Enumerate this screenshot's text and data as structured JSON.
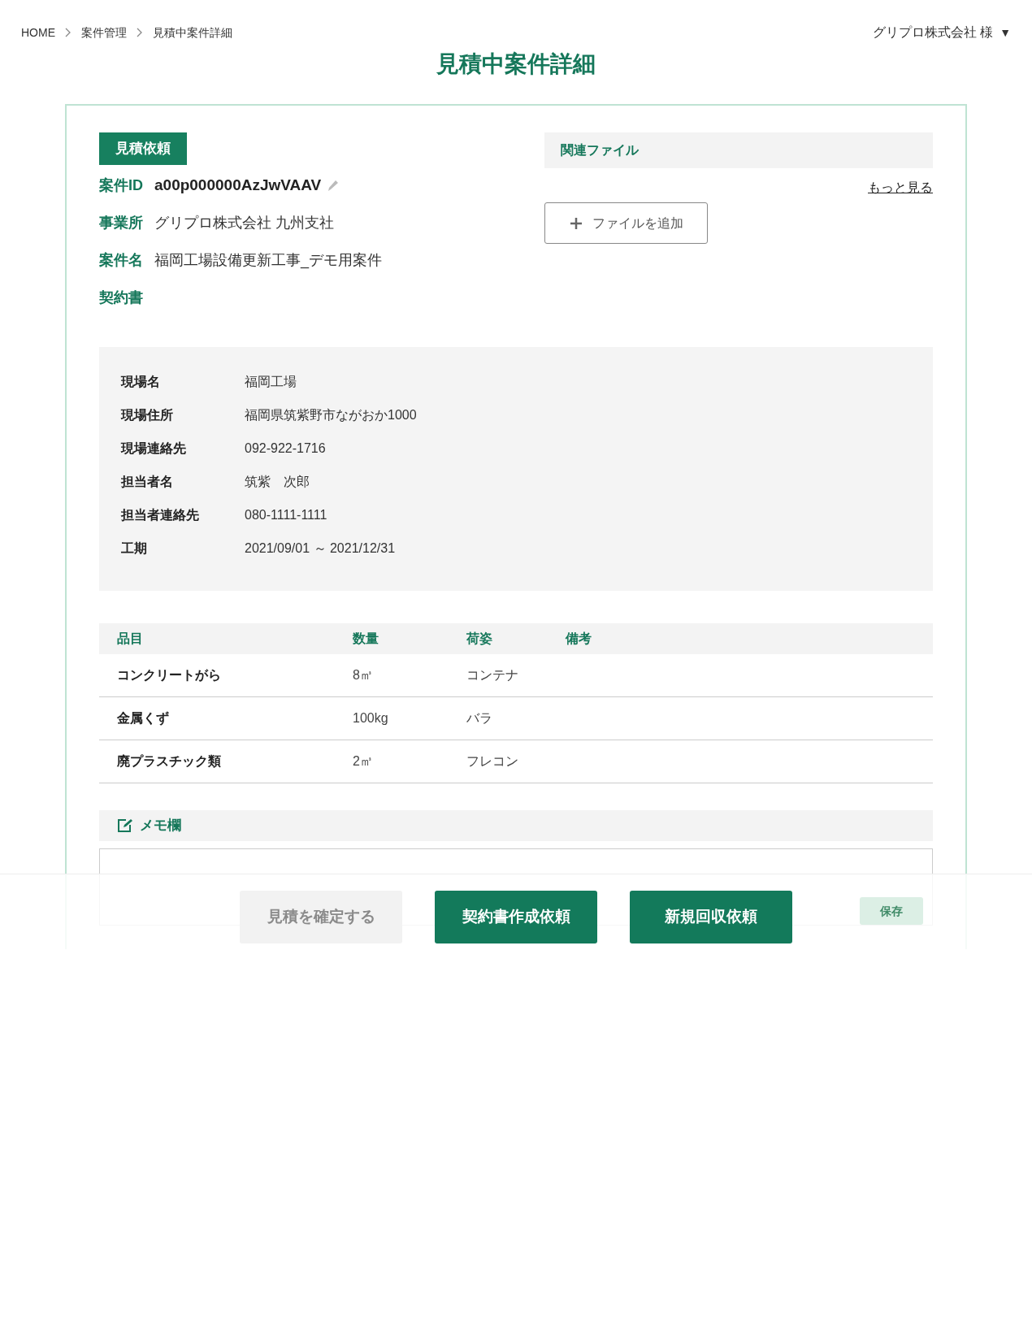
{
  "breadcrumb": [
    {
      "label": "HOME"
    },
    {
      "label": "案件管理"
    },
    {
      "label": "見積中案件詳細"
    }
  ],
  "user_menu": {
    "label": "グリプロ株式会社 様",
    "caret": "▼"
  },
  "title": "見積中案件詳細",
  "status_badge": "見積依頼",
  "fields": [
    {
      "label": "案件ID",
      "value": "a00p000000AzJwVAAV",
      "editable": true
    },
    {
      "label": "事業所",
      "value": "グリプロ株式会社 九州支社",
      "editable": false
    },
    {
      "label": "案件名",
      "value": "福岡工場設備更新工事_デモ用案件",
      "editable": false
    },
    {
      "label": "契約書",
      "editable": false
    }
  ],
  "related_files": {
    "title": "関連ファイル",
    "more_link": "もっと見る",
    "add_button": "ファイルを追加"
  },
  "site_info": [
    {
      "label": "現場名",
      "value": "福岡工場"
    },
    {
      "label": "現場住所",
      "value": "福岡県筑紫野市ながおか1000"
    },
    {
      "label": "現場連絡先",
      "value": "092-922-1716"
    },
    {
      "label": "担当者名",
      "value": "筑紫　次郎"
    },
    {
      "label": "担当者連絡先",
      "value": "080-1111-1111"
    },
    {
      "label": "工期",
      "value": "2021/09/01 ～ 2021/12/31"
    }
  ],
  "items_table": {
    "columns": [
      "品目",
      "数量",
      "荷姿",
      "備考"
    ],
    "rows": [
      [
        "コンクリートがら",
        "8㎥",
        "コンテナ"
      ],
      [
        "金属くず",
        "100kg",
        "バラ"
      ],
      [
        "廃プラスチック類",
        "2㎥",
        "フレコン"
      ]
    ]
  },
  "memo": {
    "title": "メモ欄"
  },
  "actions": [
    {
      "label": "見積を確定する",
      "disabled": true
    },
    {
      "label": "契約書作成依頼",
      "disabled": false
    },
    {
      "label": "新規回収依頼",
      "disabled": false
    }
  ],
  "save_button": {
    "label": "保存",
    "disabled": true
  }
}
